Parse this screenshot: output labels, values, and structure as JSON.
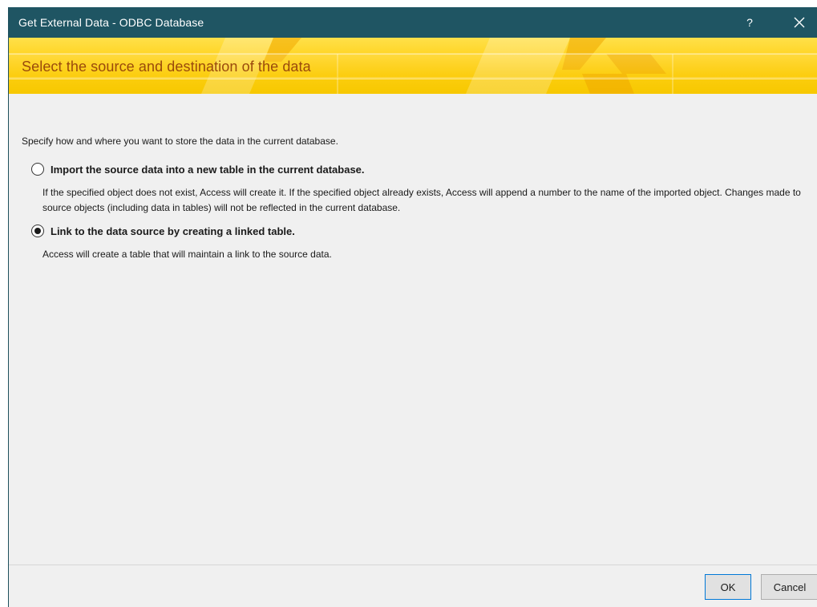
{
  "window": {
    "title": "Get External Data - ODBC Database",
    "help_label": "?",
    "close_icon": "close-icon"
  },
  "banner": {
    "heading": "Select the source and destination of the data"
  },
  "content": {
    "intro": "Specify how and where you want to store the data in the current database.",
    "options": [
      {
        "label": "Import the source data into a new table in the current database.",
        "selected": false,
        "description": "If the specified object does not exist, Access will create it. If the specified object already exists, Access will append a number to the name of the imported object. Changes made to source objects (including data in tables) will not be reflected in the current database."
      },
      {
        "label": "Link to the data source by creating a linked table.",
        "selected": true,
        "description": "Access will create a table that will maintain a link to the source data."
      }
    ]
  },
  "footer": {
    "ok_label": "OK",
    "cancel_label": "Cancel"
  },
  "colors": {
    "titlebar": "#1f5563",
    "banner": "#ffd21a",
    "heading_text": "#9a4a0c",
    "body": "#f0f0f0",
    "ok_border": "#0078d7"
  }
}
